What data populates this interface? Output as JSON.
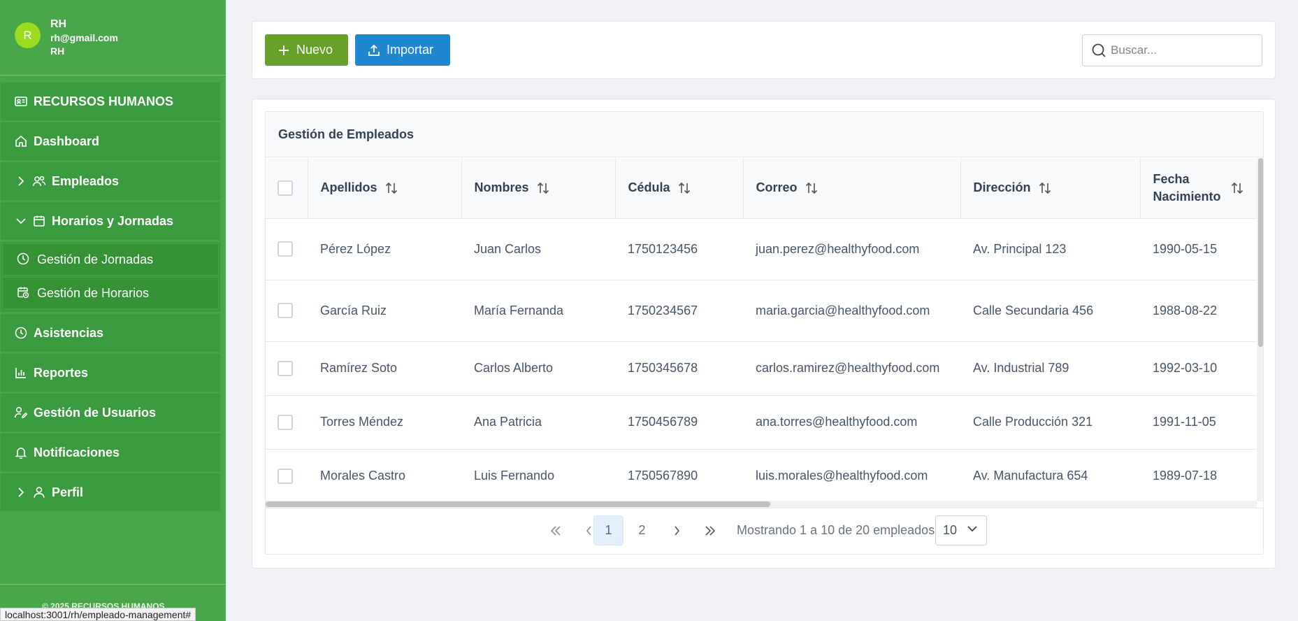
{
  "user": {
    "initial": "R",
    "name": "RH",
    "email": "rh@gmail.com",
    "role": "RH"
  },
  "menu": {
    "module": "RECURSOS HUMANOS",
    "dashboard": "Dashboard",
    "empleados": "Empleados",
    "horarios": "Horarios y Jornadas",
    "sub": [
      "Gestión de Jornadas",
      "Gestión de Horarios"
    ],
    "asistencias": "Asistencias",
    "reportes": "Reportes",
    "usuarios": "Gestión de Usuarios",
    "notificaciones": "Notificaciones",
    "perfil": "Perfil"
  },
  "footer_text": "© 2025 RECURSOS HUMANOS",
  "status_url": "localhost:3001/rh/empleado-management#",
  "toolbar": {
    "new_label": "Nuevo",
    "import_label": "Importar",
    "search_placeholder": "Buscar..."
  },
  "table": {
    "title": "Gestión de Empleados",
    "columns": [
      "Apellidos",
      "Nombres",
      "Cédula",
      "Correo",
      "Dirección",
      "Fecha Nacimiento"
    ],
    "rows": [
      [
        "Pérez López",
        "Juan Carlos",
        "1750123456",
        "juan.perez@healthyfood.com",
        "Av. Principal 123",
        "1990-05-15"
      ],
      [
        "García Ruiz",
        "María Fernanda",
        "1750234567",
        "maria.garcia@healthyfood.com",
        "Calle Secundaria 456",
        "1988-08-22"
      ],
      [
        "Ramírez Soto",
        "Carlos Alberto",
        "1750345678",
        "carlos.ramirez@healthyfood.com",
        "Av. Industrial 789",
        "1992-03-10"
      ],
      [
        "Torres Méndez",
        "Ana Patricia",
        "1750456789",
        "ana.torres@healthyfood.com",
        "Calle Producción 321",
        "1991-11-05"
      ],
      [
        "Morales Castro",
        "Luis Fernando",
        "1750567890",
        "luis.morales@healthyfood.com",
        "Av. Manufactura 654",
        "1989-07-18"
      ]
    ]
  },
  "pagination": {
    "pages": [
      "1",
      "2"
    ],
    "current": "1",
    "info": "Mostrando 1 a 10 de 20 empleados",
    "rows_per_page": "10"
  },
  "colors": {
    "sidebar": "#4aa64a",
    "menu_item": "#3a9a3e",
    "new_button": "#66a22a",
    "import_button": "#1f86d0"
  }
}
